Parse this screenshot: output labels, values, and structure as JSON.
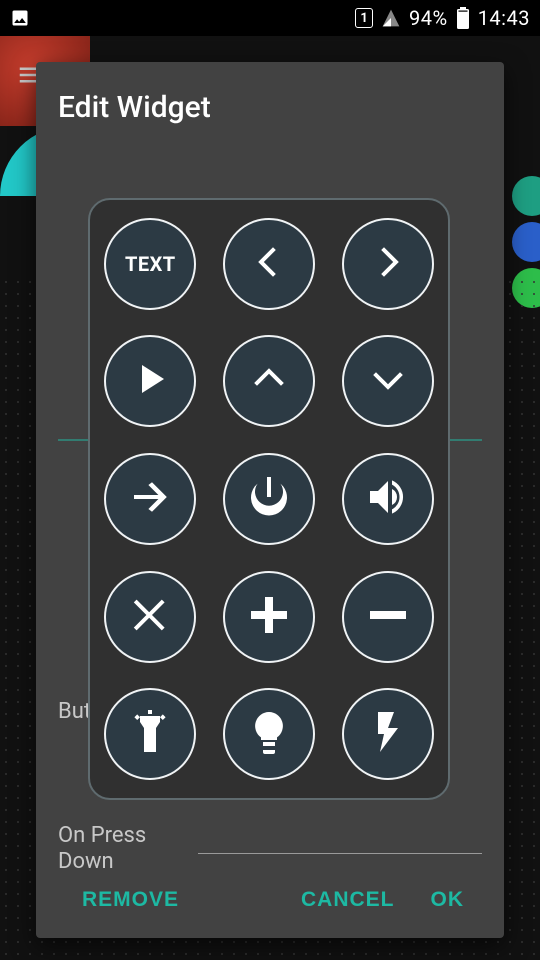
{
  "status": {
    "sim": "1",
    "battery_pct": "94%",
    "time": "14:43"
  },
  "dialog": {
    "title": "Edit Widget",
    "label_button": "Butt",
    "label_press_down": "On Press\nDown",
    "actions": {
      "remove": "REMOVE",
      "cancel": "CANCEL",
      "ok": "OK"
    }
  },
  "picker": {
    "text_option": "TEXT",
    "icons": [
      "text",
      "chevron-left",
      "chevron-right",
      "play",
      "chevron-up",
      "chevron-down",
      "arrow-right",
      "power",
      "volume",
      "close",
      "plus",
      "minus",
      "flashlight",
      "bulb",
      "bolt"
    ]
  }
}
